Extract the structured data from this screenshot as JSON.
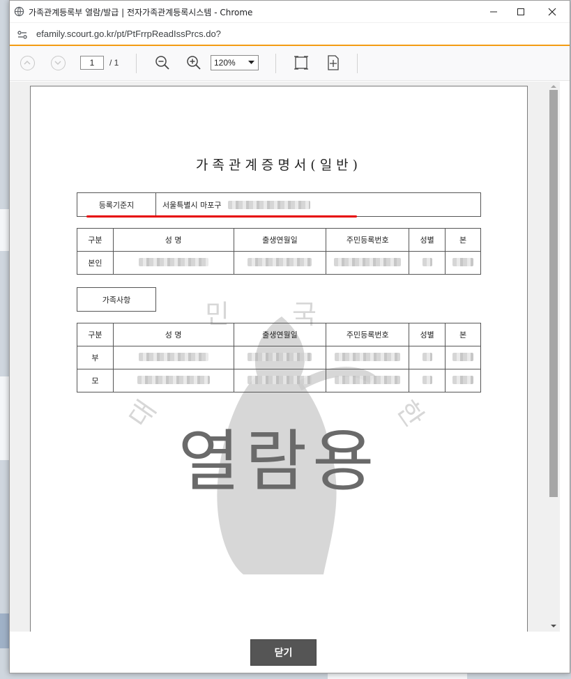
{
  "window": {
    "title": "가족관계등록부 열람/발급 | 전자가족관계등록시스템 - Chrome",
    "url": "efamily.scourt.go.kr/pt/PtFrrpReadIssPrcs.do?"
  },
  "pdf_toolbar": {
    "page_current": "1",
    "page_total": "/  1",
    "zoom": "120%"
  },
  "document": {
    "title": "가족관계증명서(일반)",
    "registration": {
      "label": "등록기준지",
      "value_visible": "서울특별시 마포구"
    },
    "person_table": {
      "headers": [
        "구분",
        "성      명",
        "출생연월일",
        "주민등록번호",
        "성별",
        "본"
      ],
      "row_label": "본인"
    },
    "family_section_label": "가족사항",
    "family_table": {
      "headers": [
        "구분",
        "성      명",
        "출생연월일",
        "주민등록번호",
        "성별",
        "본"
      ],
      "rows": [
        "부",
        "모"
      ]
    },
    "watermark": {
      "stamp": "열람용",
      "seal_chars": [
        "대",
        "민",
        "국",
        "한"
      ]
    }
  },
  "footer": {
    "close_label": "닫기"
  },
  "colors": {
    "accent_line": "#f39c12",
    "underline": "#e60000",
    "close_button": "#555555"
  }
}
